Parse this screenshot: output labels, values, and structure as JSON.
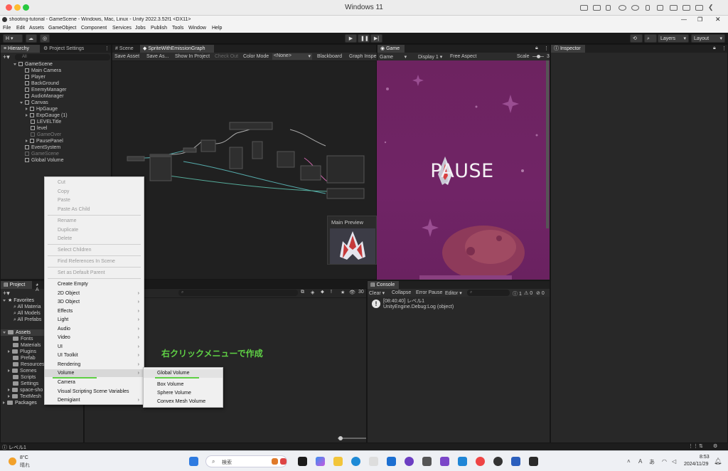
{
  "mac": {
    "title": "Windows 11"
  },
  "window": {
    "title": "shooting-tutorial - GameScene - Windows, Mac, Linux - Unity 2022.3.52f1 <DX11>",
    "menu": [
      "File",
      "Edit",
      "Assets",
      "GameObject",
      "Component",
      "Services",
      "Jobs",
      "Publish",
      "Tools",
      "Window",
      "Help"
    ]
  },
  "toolbar": {
    "account": "H",
    "layers": "Layers",
    "layout": "Layout"
  },
  "hierarchy": {
    "tabs": [
      "Hierarchy",
      "Project Settings"
    ],
    "search_placeholder": "All",
    "items": [
      {
        "label": "GameScene"
      },
      {
        "label": "Main Camera"
      },
      {
        "label": "Player"
      },
      {
        "label": "BackGround"
      },
      {
        "label": "EnemyManager"
      },
      {
        "label": "AudioManager"
      },
      {
        "label": "Canvas"
      },
      {
        "label": "HpGauge"
      },
      {
        "label": "ExpGauge (1)"
      },
      {
        "label": "LEVELTitle"
      },
      {
        "label": "level"
      },
      {
        "label": "GameOver"
      },
      {
        "label": "PausePanel"
      },
      {
        "label": "EventSystem"
      },
      {
        "label": "GameScene"
      },
      {
        "label": "Global Volume"
      }
    ]
  },
  "scene": {
    "tabs": [
      "Scene",
      "SpriteWithEmissionGraph"
    ],
    "toolbar": [
      "Save Asset",
      "Save As...",
      "Show In Project",
      "Check Out",
      "Color Mode",
      "<None>",
      "Blackboard",
      "Graph Inspe"
    ],
    "preview_label": "Main Preview"
  },
  "game": {
    "tab": "Game",
    "toolbar": [
      "Game",
      "Display 1",
      "Free Aspect",
      "Scale",
      "3"
    ],
    "pause_text": "PAUSE"
  },
  "inspector": {
    "tab": "Inspector"
  },
  "project": {
    "tabs": [
      "Project",
      "A"
    ],
    "favorites_label": "Favorites",
    "favorites": [
      "All Materia",
      "All Models",
      "All Prefabs"
    ],
    "assets_label": "Assets",
    "assets": [
      "Fonts",
      "Materials",
      "Plugins",
      "Prefab",
      "Resources",
      "Scenes",
      "Scripts",
      "Settings",
      "space-sho",
      "TextMesh"
    ],
    "packages_label": "Packages",
    "count": "30"
  },
  "console": {
    "tab": "Console",
    "toolbar": [
      "Clear",
      "Collapse",
      "Error Pause",
      "Editor"
    ],
    "counts": [
      "1",
      "0",
      "0"
    ],
    "log_line1": "[08:40:40] レベル1",
    "log_line2": "UnityEngine.Debug:Log (object)"
  },
  "context_menu": {
    "items": [
      "Cut",
      "Copy",
      "Paste",
      "Paste As Child",
      "Rename",
      "Duplicate",
      "Delete",
      "Select Children",
      "Find References In Scene",
      "Set as Default Parent",
      "Create Empty",
      "2D Object",
      "3D Object",
      "Effects",
      "Light",
      "Audio",
      "Video",
      "UI",
      "UI Toolkit",
      "Rendering",
      "Volume",
      "Camera",
      "Visual Scripting Scene Variables",
      "Demigiant"
    ]
  },
  "submenu": {
    "items": [
      "Global Volume",
      "Box Volume",
      "Sphere Volume",
      "Convex Mesh Volume"
    ]
  },
  "annotation": {
    "text": "右クリックメニューで作成",
    "color": "#5fd045"
  },
  "statusbar": {
    "text": "レベル1"
  },
  "taskbar": {
    "weather_temp": "8°C",
    "weather_desc": "晴れ",
    "search": "検索",
    "time": "8:53",
    "date": "2024/11/29"
  }
}
